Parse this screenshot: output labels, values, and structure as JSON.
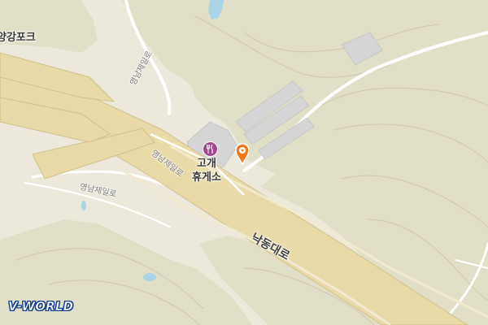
{
  "map": {
    "colors": {
      "background": "#ece9dc",
      "highlands": "#e2dfc8",
      "contour": "#cfc9ad",
      "road_fill": "#e8dba8",
      "road_edge": "#d2c28a",
      "building": "#d5d5d5",
      "water": "#a9d3e6",
      "local_road": "#ffffff"
    },
    "labels": {
      "place_topleft": "양강포크",
      "road_vertical": "영남제일로",
      "road_middle": "영남제일로",
      "road_left": "영남제일로",
      "highway": "낙동대로"
    },
    "poi": {
      "name_line1": "고개",
      "name_line2": "휴게소",
      "icon": "fork-knife-icon",
      "icon_color": "#a3448e"
    },
    "marker": {
      "icon": "location-pin-icon",
      "color": "#f07a1a"
    },
    "logo": {
      "text": "V-WORLD",
      "color": "#123e8e"
    }
  }
}
